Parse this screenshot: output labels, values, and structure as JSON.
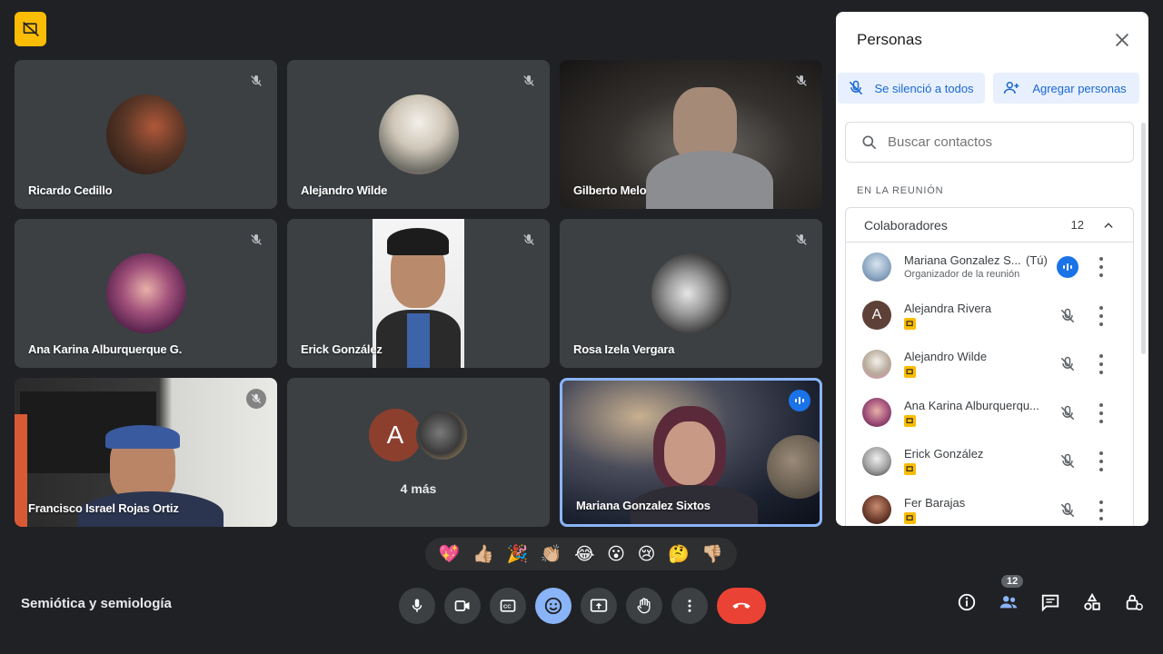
{
  "meeting": {
    "title": "Semiótica y semiología"
  },
  "tiles": [
    {
      "name": "Ricardo Cedillo"
    },
    {
      "name": "Alejandro Wilde"
    },
    {
      "name": "Gilberto Melo"
    },
    {
      "name": "Ana Karina Alburquerque G."
    },
    {
      "name": "Erick González"
    },
    {
      "name": "Rosa Izela Vergara"
    },
    {
      "name": "Francisco Israel Rojas Ortiz"
    },
    {
      "more_label": "4 más",
      "initial": "A"
    },
    {
      "name": "Mariana Gonzalez Sixtos"
    }
  ],
  "reactions": [
    "💖",
    "👍🏼",
    "🎉",
    "👏🏼",
    "😂",
    "😮",
    "😢",
    "🤔",
    "👎🏼"
  ],
  "controls": {
    "mic": "microphone-icon",
    "camera": "camera-icon",
    "captions": "captions-icon",
    "emoji": "emoji-icon",
    "present": "present-icon",
    "hand": "raise-hand-icon",
    "more": "more-options-icon",
    "end": "end-call-icon"
  },
  "right_controls": {
    "people_count": "12"
  },
  "panel": {
    "title": "Personas",
    "mute_all_label": "Se silenció a todos",
    "add_people_label": "Agregar personas",
    "search_placeholder": "Buscar contactos",
    "section_label": "EN LA REUNIÓN",
    "group_label": "Colaboradores",
    "group_count": "12",
    "people": [
      {
        "name": "Mariana Gonzalez S...",
        "tag": "(Tú)",
        "subtitle": "Organizador de la reunión"
      },
      {
        "name": "Alejandra Rivera",
        "initial": "A"
      },
      {
        "name": "Alejandro Wilde"
      },
      {
        "name": "Ana Karina Alburquerqu..."
      },
      {
        "name": "Erick González"
      },
      {
        "name": "Fer Barajas"
      }
    ]
  },
  "colors": {
    "accent": "#8ab4f8",
    "end_call": "#ea4335",
    "host_badge": "#fbbc04",
    "speaking": "#1a73e8"
  }
}
